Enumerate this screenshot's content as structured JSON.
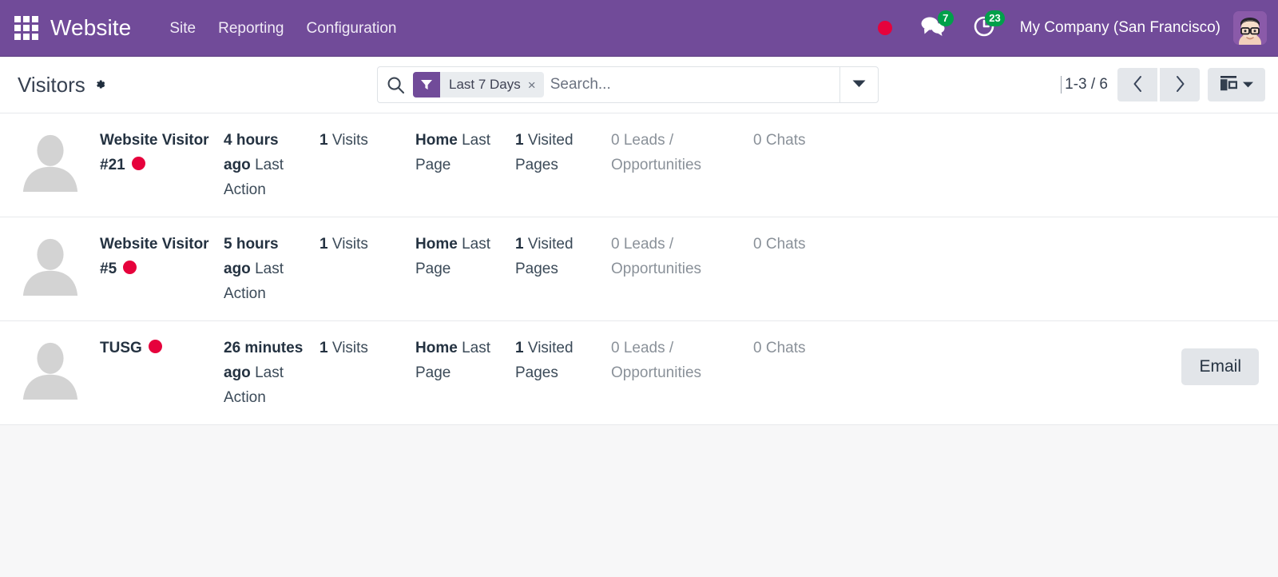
{
  "navbar": {
    "apps_icon": "apps-grid-icon",
    "brand": "Website",
    "menu": [
      {
        "label": "Site"
      },
      {
        "label": "Reporting"
      },
      {
        "label": "Configuration"
      }
    ],
    "recording_dot": "record-dot-icon",
    "messages": {
      "icon": "messages-icon",
      "count": "7"
    },
    "activities": {
      "icon": "activities-clock-icon",
      "count": "23"
    },
    "company": "My Company (San Francisco)",
    "avatar": "user-avatar"
  },
  "control_panel": {
    "title": "Visitors",
    "settings_icon": "gear-icon",
    "search": {
      "icon": "search-icon",
      "placeholder": "Search...",
      "facet": {
        "icon": "filter-icon",
        "label": "Last 7 Days",
        "remove": "×"
      },
      "toggle_icon": "chevron-down-icon"
    },
    "pager": {
      "range": "1-3 / 6",
      "previous_icon": "chevron-left-icon",
      "next_icon": "chevron-right-icon"
    },
    "view_switcher": {
      "icon": "kanban-view-icon",
      "caret": "caret-down-icon"
    }
  },
  "colors": {
    "brand_purple": "#714B99",
    "live_red": "#e6023c",
    "badge_green": "#00a04a",
    "button_gray": "#e4e7eb"
  },
  "list": {
    "rows": [
      {
        "avatar": "visitor-placeholder-avatar",
        "name": "Website Visitor #21",
        "is_connected": true,
        "last_action_value": "4 hours ago",
        "last_action_label": "Last Action",
        "visits_value": "1",
        "visits_label": "Visits",
        "last_page_value": "Home",
        "last_page_label": "Last Page",
        "visited_pages_value": "1",
        "visited_pages_label": "Visited Pages",
        "leads_value": "0",
        "leads_label": "Leads / Opportunities",
        "chats_value": "0",
        "chats_label": "Chats",
        "action_button": null
      },
      {
        "avatar": "visitor-placeholder-avatar",
        "name": "Website Visitor #5",
        "is_connected": true,
        "last_action_value": "5 hours ago",
        "last_action_label": "Last Action",
        "visits_value": "1",
        "visits_label": "Visits",
        "last_page_value": "Home",
        "last_page_label": "Last Page",
        "visited_pages_value": "1",
        "visited_pages_label": "Visited Pages",
        "leads_value": "0",
        "leads_label": "Leads / Opportunities",
        "chats_value": "0",
        "chats_label": "Chats",
        "action_button": null
      },
      {
        "avatar": "visitor-placeholder-avatar",
        "name": "TUSG",
        "is_connected": true,
        "last_action_value": "26 minutes ago",
        "last_action_label": "Last Action",
        "visits_value": "1",
        "visits_label": "Visits",
        "last_page_value": "Home",
        "last_page_label": "Last Page",
        "visited_pages_value": "1",
        "visited_pages_label": "Visited Pages",
        "leads_value": "0",
        "leads_label": "Leads / Opportunities",
        "chats_value": "0",
        "chats_label": "Chats",
        "action_button": "Email"
      }
    ]
  }
}
